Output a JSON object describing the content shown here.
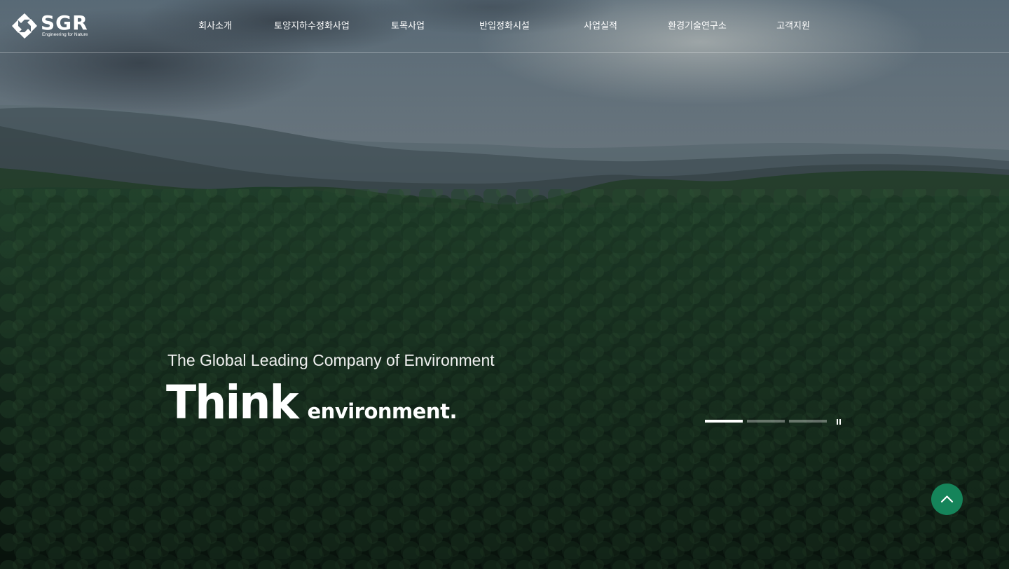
{
  "brand": {
    "logo_text": "SGR",
    "logo_subtitle": "Engineering for Nature"
  },
  "nav": {
    "items": [
      {
        "label": "회사소개"
      },
      {
        "label": "토양지하수정화사업"
      },
      {
        "label": "토목사업"
      },
      {
        "label": "반입정화시설"
      },
      {
        "label": "사업실적"
      },
      {
        "label": "환경기술연구소"
      },
      {
        "label": "고객지원"
      }
    ]
  },
  "hero": {
    "tagline": "The Global Leading Company of Environment",
    "headline_big": "Think",
    "headline_small": "environment."
  },
  "slider": {
    "total_slides": 3,
    "current_slide": 1,
    "current_progress": 1.0
  },
  "icons": {
    "logo": "sgr-logo-icon",
    "pause": "pause-icon",
    "scroll_top": "chevron-up-icon"
  },
  "colors": {
    "accent": "#15845a",
    "text": "#ffffff",
    "pagination_inactive": "rgba(255,255,255,0.35)"
  }
}
